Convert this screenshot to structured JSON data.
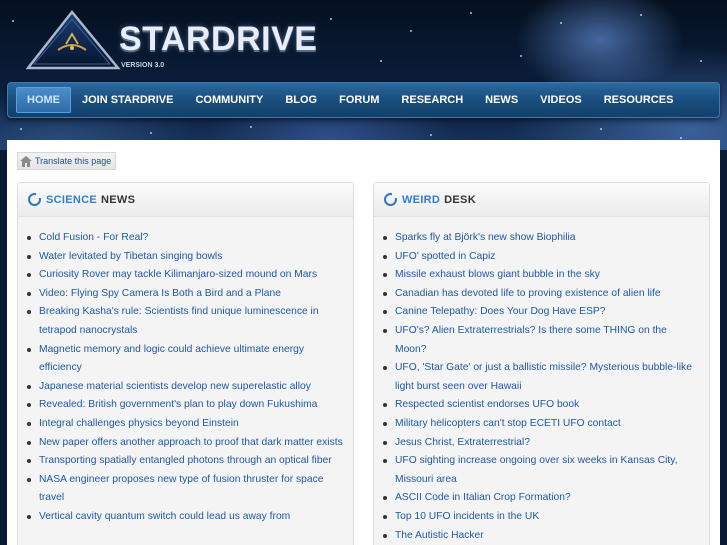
{
  "logo": {
    "title": "STARDRIVE",
    "version": "VERSION 3.0"
  },
  "nav": {
    "items": [
      {
        "label": "HOME",
        "active": true
      },
      {
        "label": "JOIN STARDRIVE"
      },
      {
        "label": "COMMUNITY"
      },
      {
        "label": "BLOG"
      },
      {
        "label": "FORUM"
      },
      {
        "label": "RESEARCH"
      },
      {
        "label": "NEWS"
      },
      {
        "label": "VIDEOS"
      },
      {
        "label": "RESOURCES"
      }
    ]
  },
  "translate": {
    "label": "Translate this page"
  },
  "science": {
    "title_a": "SCIENCE",
    "title_b": "NEWS",
    "items": [
      "Cold Fusion - For Real?",
      "Water levitated by Tibetan singing bowls",
      "Curiosity Rover may tackle Kilimanjaro-sized mound on Mars",
      "Video: Flying Spy Camera Is Both a Bird and a Plane",
      "Breaking Kasha's rule: Scientists find unique luminescence in tetrapod nanocrystals",
      "Magnetic memory and logic could achieve ultimate energy efficiency",
      "Japanese material scientists develop new superelastic alloy",
      "Revealed: British government's plan to play down Fukushima",
      "Integral challenges physics beyond Einstein",
      "New paper offers another approach to proof that dark matter exists",
      "Transporting spatially entangled photons through an optical fiber",
      "NASA engineer proposes new type of fusion thruster for space travel",
      "Vertical cavity quantum switch could lead us away from"
    ]
  },
  "weird": {
    "title_a": "WEIRD",
    "title_b": "DESK",
    "items": [
      "Sparks fly at Björk's new show Biophilia",
      "UFO' spotted in Capiz",
      "Missile exhaust blows giant bubble in the sky",
      "Canadian has devoted life to proving existence of alien life",
      "Canine Telepathy: Does Your Dog Have ESP?",
      "UFO's? Alien Extraterrestrials? Is there some THING on the Moon?",
      "UFO, 'Star Gate' or just a ballistic missile? Mysterious bubble-like light burst seen over Hawaii",
      "Respected scientist endorses UFO book",
      "Military helicopters can't stop ECETI UFO contact",
      "Jesus Christ, Extraterrestrial?",
      "UFO sighting increase ongoing over six weeks in Kansas City, Missouri area",
      "ASCII Code in Italian Crop Formation?",
      "Top 10 UFO incidents in the UK",
      "The Autistic Hacker"
    ]
  }
}
